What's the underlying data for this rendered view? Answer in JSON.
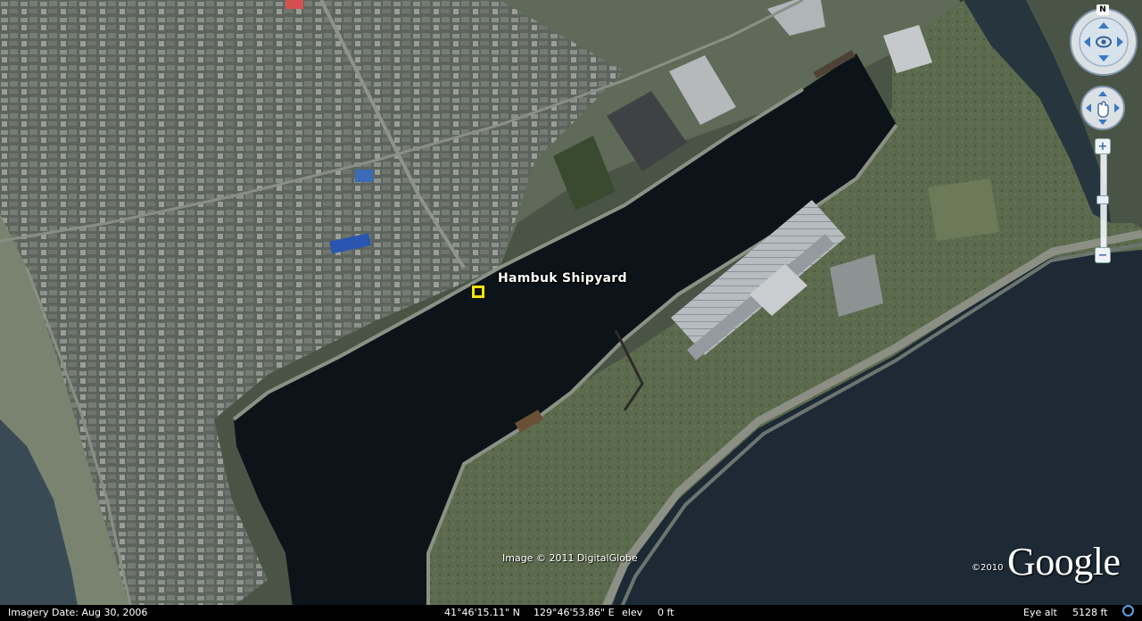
{
  "map": {
    "placemark": {
      "label": "Hambuk Shipyard"
    },
    "attribution": "Image © 2011 DigitalGlobe",
    "logo": {
      "year": "©2010",
      "word": "Google"
    }
  },
  "navigation": {
    "north_label": "N",
    "zoom_in_label": "+",
    "zoom_out_label": "−"
  },
  "status_bar": {
    "imagery_date": "Imagery Date: Aug 30, 2006",
    "latitude": "41°46'15.11\" N",
    "longitude": "129°46'53.86\" E",
    "elev_label": "elev",
    "elev_value": "0 ft",
    "eye_alt_label": "Eye alt",
    "eye_alt_value": "5128 ft"
  },
  "colors": {
    "placemark_fill": "#f5e400",
    "harbor_water": "#0d1419",
    "sea": "#1d2a35",
    "status_bar": "#000000"
  }
}
